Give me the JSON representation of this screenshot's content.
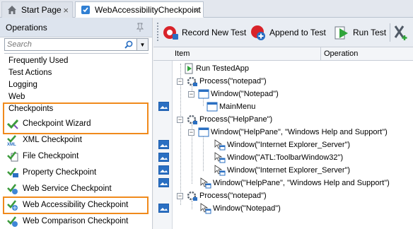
{
  "tabs": [
    {
      "label": "Start Page",
      "icon": "home-icon"
    },
    {
      "label": "WebAccessibilityCheckpoint",
      "icon": "keyword-test-icon"
    }
  ],
  "left_panel": {
    "title": "Operations",
    "search_placeholder": "Search",
    "categories": [
      "Frequently Used",
      "Test Actions",
      "Logging",
      "Web",
      "Checkpoints"
    ],
    "checkpoint_items": [
      {
        "label": "Checkpoint Wizard",
        "icon": "checkpoint-wizard-icon"
      },
      {
        "label": "XML Checkpoint",
        "icon": "xml-checkpoint-icon"
      },
      {
        "label": "File Checkpoint",
        "icon": "file-checkpoint-icon"
      },
      {
        "label": "Property Checkpoint",
        "icon": "property-checkpoint-icon"
      },
      {
        "label": "Web Service Checkpoint",
        "icon": "web-service-checkpoint-icon"
      },
      {
        "label": "Web Accessibility Checkpoint",
        "icon": "web-accessibility-checkpoint-icon"
      },
      {
        "label": "Web Comparison Checkpoint",
        "icon": "web-comparison-checkpoint-icon"
      }
    ],
    "highlight_color": "#f08a1c"
  },
  "toolbar": {
    "record_new_test": "Record New Test",
    "append_to_test": "Append to Test",
    "run_test": "Run Test"
  },
  "grid": {
    "columns": [
      "Item",
      "Operation"
    ],
    "rows": [
      {
        "text": "Run TestedApp",
        "icon": "run-tested-app-icon"
      },
      {
        "text": "Process(\"notepad\")",
        "icon": "process-icon"
      },
      {
        "text": "Window(\"Notepad\")",
        "icon": "window-icon"
      },
      {
        "text": "MainMenu",
        "icon": "menu-icon"
      },
      {
        "text": "Process(\"HelpPane\")",
        "icon": "process-icon"
      },
      {
        "text": "Window(\"HelpPane\", \"Windows Help and Support\")",
        "icon": "window-icon"
      },
      {
        "text": "Window(\"Internet Explorer_Server\")",
        "icon": "window-arrow-icon"
      },
      {
        "text": "Window(\"ATL:ToolbarWindow32\")",
        "icon": "window-arrow-icon"
      },
      {
        "text": "Window(\"Internet Explorer_Server\")",
        "icon": "window-arrow-icon"
      },
      {
        "text": "Window(\"HelpPane\", \"Windows Help and Support\")",
        "icon": "window-arrow-icon"
      },
      {
        "text": "Process(\"notepad\")",
        "icon": "process-icon"
      },
      {
        "text": "Window(\"Notepad\")",
        "icon": "window-arrow-icon"
      }
    ]
  }
}
